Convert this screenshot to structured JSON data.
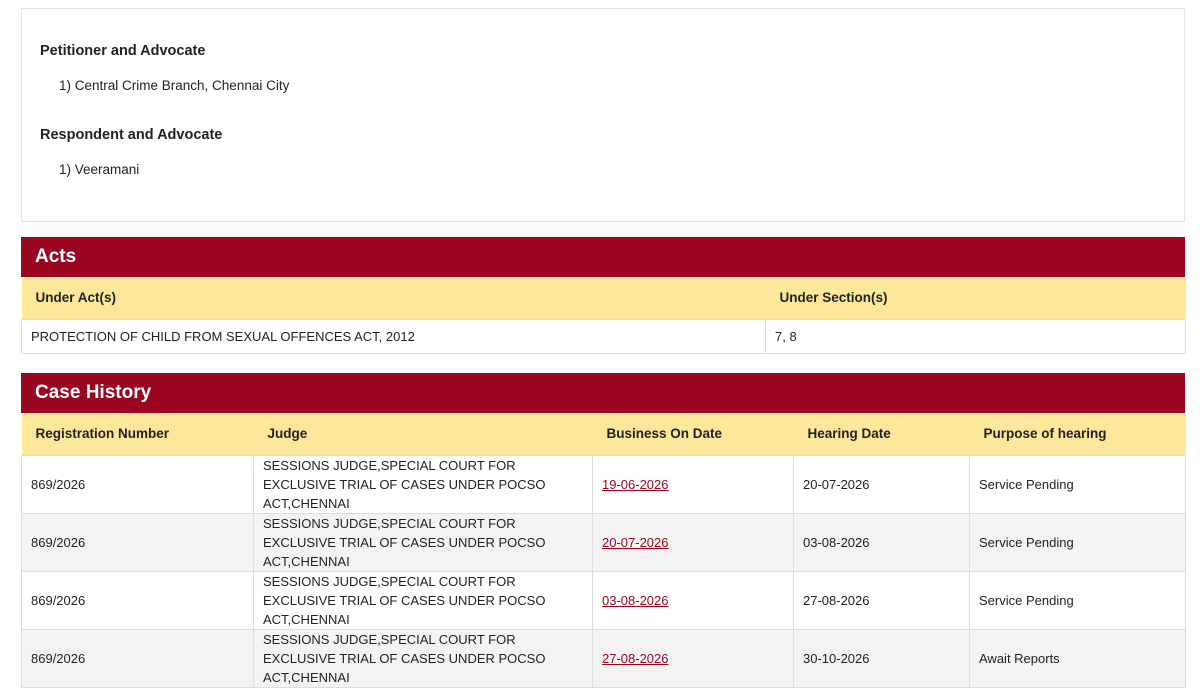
{
  "parties": {
    "petitioner_heading": "Petitioner and Advocate",
    "petitioner": "1) Central Crime Branch, Chennai City",
    "respondent_heading": "Respondent and Advocate",
    "respondent": "1) Veeramani"
  },
  "acts": {
    "title": "Acts",
    "headers": [
      "Under Act(s)",
      "Under Section(s)"
    ],
    "rows": [
      {
        "act": "PROTECTION OF CHILD FROM SEXUAL OFFENCES ACT, 2012",
        "section": "7, 8"
      }
    ]
  },
  "history": {
    "title": "Case History",
    "headers": [
      "Registration Number",
      "Judge",
      "Business On Date",
      "Hearing Date",
      "Purpose of hearing"
    ],
    "rows": [
      {
        "reg": "869/2026",
        "judge": "SESSIONS JUDGE,SPECIAL COURT FOR EXCLUSIVE TRIAL OF CASES UNDER POCSO ACT,CHENNAI",
        "business": "19-06-2026",
        "hearing": "20-07-2026",
        "purpose": "Service Pending"
      },
      {
        "reg": "869/2026",
        "judge": "SESSIONS JUDGE,SPECIAL COURT FOR EXCLUSIVE TRIAL OF CASES UNDER POCSO ACT,CHENNAI",
        "business": "20-07-2026",
        "hearing": "03-08-2026",
        "purpose": "Service Pending"
      },
      {
        "reg": "869/2026",
        "judge": "SESSIONS JUDGE,SPECIAL COURT FOR EXCLUSIVE TRIAL OF CASES UNDER POCSO ACT,CHENNAI",
        "business": "03-08-2026",
        "hearing": "27-08-2026",
        "purpose": "Service Pending"
      },
      {
        "reg": "869/2026",
        "judge": "SESSIONS JUDGE,SPECIAL COURT FOR EXCLUSIVE TRIAL OF CASES UNDER POCSO ACT,CHENNAI",
        "business": "27-08-2026",
        "hearing": "30-10-2026",
        "purpose": "Await Reports"
      }
    ]
  },
  "colors": {
    "accent": "#9a0620",
    "header_row": "#fde79b",
    "alt_row": "#f3f3f3"
  }
}
